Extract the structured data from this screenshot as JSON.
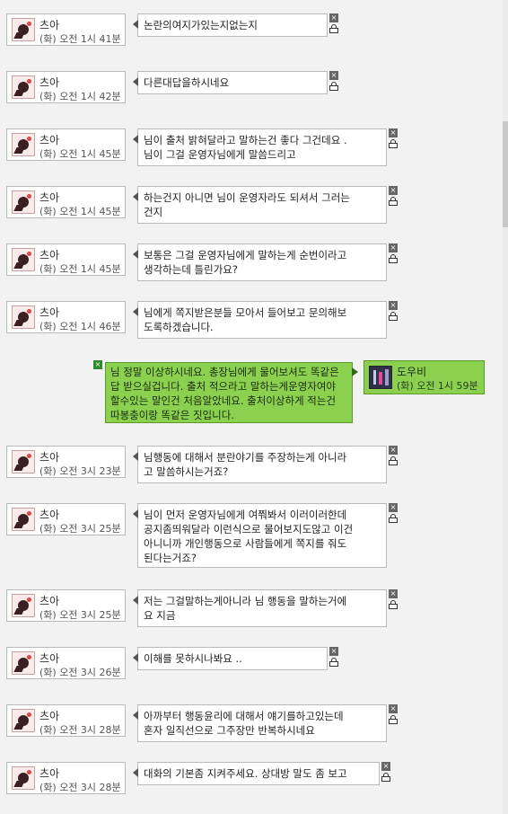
{
  "sender": {
    "name": "츠아"
  },
  "contact": {
    "name": "도우비",
    "time": "(화) 오전 1시 59분"
  },
  "outgoing": {
    "lines": [
      "님 정말 이상하시네요. 총장님에게 물어보셔도 똑",
      "같은 답 받으실겁니다. 출처 적으라고 말하는게",
      "운영자여야 할수있는 말인건 처음알았네요. 출처",
      "이상하게 적는건 따봉충이랑 똑같은 짓입니다."
    ]
  },
  "messages": [
    {
      "time": "(화) 오전 1시 41분",
      "lines": [
        "논란의여지가있는지없는지"
      ]
    },
    {
      "time": "(화) 오전 1시 42분",
      "lines": [
        "다른대답을하시네요"
      ]
    },
    {
      "time": "(화) 오전 1시 45분",
      "lines": [
        "님이 출처 밝혀달라고 말하는건 좋다 그건데요 .",
        "님이 그걸 운영자님에게 말씀드리고"
      ]
    },
    {
      "time": "(화) 오전 1시 45분",
      "lines": [
        "하는건지 아니면 님이 운영자라도 되셔서 그러는",
        "건지"
      ]
    },
    {
      "time": "(화) 오전 1시 45분",
      "lines": [
        "보통은 그걸 운영자님에게 말하는게 순번이라고",
        "생각하는데 틀린가요?"
      ]
    },
    {
      "time": "(화) 오전 1시 46분",
      "lines": [
        "님에게 쪽지받은분들 모아서 들어보고 문의해보",
        "도록하겠습니다."
      ]
    },
    {
      "time": "(화) 오전 3시 23분",
      "lines": [
        "님행동에 대해서 분란야기를 주장하는게 아니라",
        "고 말씀하시는거죠?"
      ]
    },
    {
      "time": "(화) 오전 3시 25분",
      "lines": [
        "님이 먼저 운영자님에게 여쭤봐서 이러이러한데",
        "공지좀띄워달라 이런식으로 물어보지도않고 이건",
        "아니니까 개인행동으로 사람들에게 쪽지를 줘도",
        "된다는거죠?"
      ]
    },
    {
      "time": "(화) 오전 3시 25분",
      "lines": [
        "저는 그걸말하는게아니라 님 행동을 말하는거에",
        "요 지금"
      ]
    },
    {
      "time": "(화) 오전 3시 26분",
      "lines": [
        "이해를 못하시나봐요 .."
      ]
    },
    {
      "time": "(화) 오전 3시 28분",
      "lines": [
        "아까부터 행동윤리에 대해서 얘기를하고있는데",
        "혼자 일직선으로 그주장만 반복하시네요"
      ]
    },
    {
      "time": "(화) 오전 3시 28분",
      "lines": [
        "대화의 기본좀 지켜주세요. 상대방 말도 좀 보고"
      ]
    }
  ]
}
